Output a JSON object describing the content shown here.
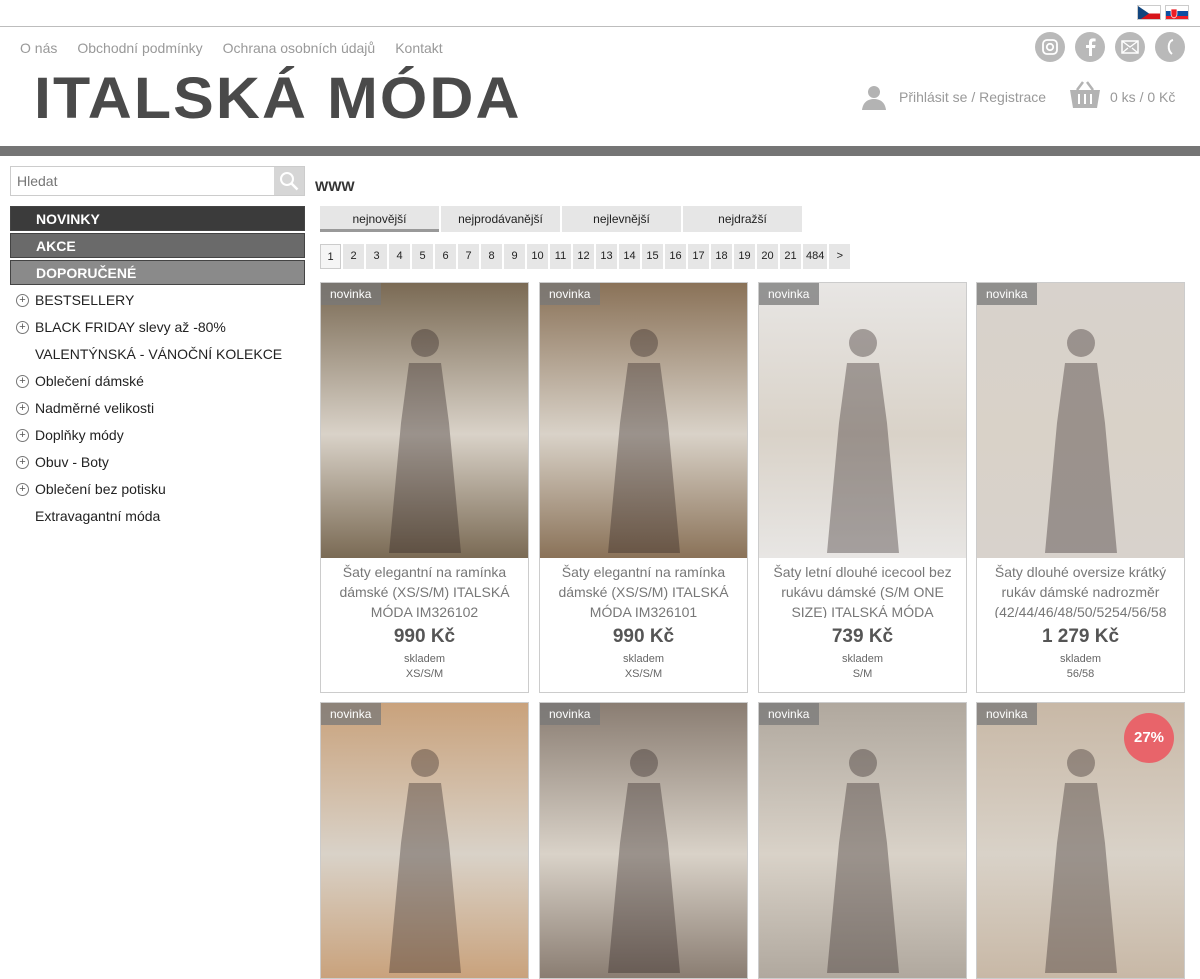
{
  "nav": {
    "about": "O nás",
    "terms": "Obchodní podmínky",
    "privacy": "Ochrana osobních údajů",
    "contact": "Kontakt"
  },
  "logo": "ITALSKÁ MÓDA",
  "login": "Přihlásit se / Registrace",
  "cart": "0 ks / 0 Kč",
  "search": {
    "placeholder": "Hledat"
  },
  "sidebar": {
    "highlights": [
      "NOVINKY",
      "AKCE",
      "DOPORUČENÉ"
    ],
    "items": [
      "BESTSELLERY",
      "BLACK FRIDAY slevy až -80%",
      "VALENTÝNSKÁ - VÁNOČNÍ KOLEKCE",
      "Oblečení dámské",
      "Nadměrné velikosti",
      "Doplňky módy",
      "Obuv - Boty",
      "Oblečení bez potisku",
      "Extravagantní móda"
    ]
  },
  "heading": "WWW",
  "sort": [
    "nejnovější",
    "nejprodávanější",
    "nejlevnější",
    "nejdražší"
  ],
  "pager": [
    "1",
    "2",
    "3",
    "4",
    "5",
    "6",
    "7",
    "8",
    "9",
    "10",
    "11",
    "12",
    "13",
    "14",
    "15",
    "16",
    "17",
    "18",
    "19",
    "20",
    "21",
    "484",
    ">"
  ],
  "products": [
    {
      "badge": "novinka",
      "name": "Šaty elegantní na ramínka dámské (XS/S/M) ITALSKÁ MÓDA IM326102",
      "price": "990 Kč",
      "stock": "skladem",
      "size": "XS/S/M",
      "color": "#7a6a54"
    },
    {
      "badge": "novinka",
      "name": "Šaty elegantní na ramínka dámské (XS/S/M) ITALSKÁ MÓDA IM326101",
      "price": "990 Kč",
      "stock": "skladem",
      "size": "XS/S/M",
      "color": "#8a7258"
    },
    {
      "badge": "novinka",
      "name": "Šaty letní dlouhé icecool bez rukávu dámské (S/M ONE SIZE) ITALSKÁ MÓDA",
      "price": "739 Kč",
      "stock": "skladem",
      "size": "S/M",
      "color": "#e8e6e4"
    },
    {
      "badge": "novinka",
      "name": "Šaty dlouhé oversize krátký rukáv dámské nadrozměr (42/44/46/48/50/5254/56/58",
      "price": "1 279 Kč",
      "stock": "skladem",
      "size": "56/58",
      "color": "#d8d2cc"
    },
    {
      "badge": "novinka",
      "color": "#c9a27c"
    },
    {
      "badge": "novinka",
      "color": "#8a7d72"
    },
    {
      "badge": "novinka",
      "color": "#b0a89e"
    },
    {
      "badge": "novinka",
      "color": "#c8b8a6"
    }
  ],
  "discount": "27%"
}
